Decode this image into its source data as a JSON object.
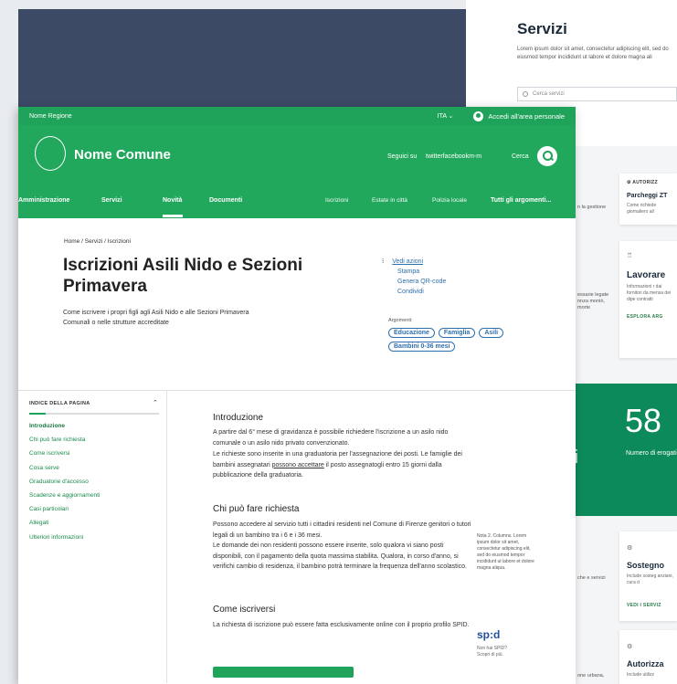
{
  "background": {
    "servizi_title": "Servizi",
    "servizi_desc": "Lorem ipsum dolor sit amet, consectetur adipiscing elit, sed do eiusmod tempor incididunt ut labore et dolore magna ali",
    "search_placeholder": "Cerca servizi",
    "card1_cat": "AUTORIZZ",
    "card1_title": "Parcheggi ZT",
    "card1_desc": "Come richiede giornaliero all",
    "card2_title": "Lavorare",
    "card2_desc": "Informazioni r dai fornitori da mensa dei dipe contratti",
    "card2_link": "ESPLORA ARG",
    "edge1": "n la gestione",
    "edge2": "essarie legate nnza moniò, morte",
    "stat_number": "58",
    "stat_label": "Numero di erogati",
    "stat_prefix": "ri",
    "card3_title": "Sostegno",
    "card3_desc": "Include sosteg anziani, cura d",
    "card3_link": "VEDI I SERVIZ",
    "edge3": "che e servizi",
    "card4_title": "Autorizza",
    "card4_desc": "Include utilizz",
    "edge4": "one urbana,"
  },
  "topbar": {
    "region": "Nome Regione",
    "lang": "ITA ⌄",
    "account": "Accedi all'area personale"
  },
  "header": {
    "site_name": "Nome Comune",
    "follow": "Seguici su",
    "social": "twitterfacebookm-m",
    "search": "Cerca"
  },
  "nav": {
    "items": [
      "Amministrazione",
      "Servizi",
      "Novità",
      "Documenti"
    ],
    "right_items": [
      "Iscrizioni",
      "Estate in città",
      "Polizia locale"
    ],
    "all_topics": "Tutti gli argomenti..."
  },
  "page": {
    "breadcrumb": "Home / Servizi / Iscrizioni",
    "title": "Iscrizioni Asili Nido e Sezioni Primavera",
    "subtitle": "Come iscrivere i propri figli agli Asili Nido e alle Sezioni Primavera Comunali o nelle strutture accreditate",
    "see_actions": "Vedi azioni",
    "actions": [
      "Stampa",
      "Genera QR-code",
      "Condividi"
    ],
    "topics_label": "Argomenti:",
    "topics": [
      "Educazione",
      "Famiglia",
      "Asili",
      "Bambini 0-36 mesi"
    ]
  },
  "toc": {
    "header": "INDICE DELLA PAGINA",
    "items": [
      "Introduzione",
      "Chi può fare richiesta",
      "Come iscriversi",
      "Cosa serve",
      "Graduatorie d'accesso",
      "Scadenze e aggiornamenti",
      "Casi particolari",
      "Allegati",
      "Ulteriori informazioni"
    ]
  },
  "sections": {
    "intro_title": "Introduzione",
    "intro_p1": "A partire dal 6° mese di gravidanza è possibile richiedere l'iscrizione a un asilo nido comunale o un asilo nido privato convenzionato.",
    "intro_p2a": "Le richieste sono inserite in una graduatoria per l'assegnazione dei posti. Le famiglie dei bambini assegnatari ",
    "intro_p2_link": "possono accettare",
    "intro_p2b": " il posto assegnatogli entro 15 giorni dalla pubblicazione della graduatoria.",
    "who_title": "Chi può fare richiesta",
    "who_p1": "Possono accedere al servizio tutti i cittadini residenti nel Comune di Firenze genitori o tutori legali di un bambino tra i 6 e i 36 mesi.",
    "who_p2": "Le domande dei non residenti possono essere inserite, solo qualora vi siano posti disponibili, con il pagamento della quota massima stabilita. Qualora, in corso d'anno, si verifichi cambio di residenza, il bambino potrà terminare la frequenza dell'anno scolastico.",
    "how_title": "Come iscriversi",
    "how_p1": "La richiesta di iscrizione può essere fatta esclusivamente online con il proprio profilo SPID."
  },
  "side": {
    "note": "Nota 2. Columns. Lorem ipsum dolor sit amet, consectetur adipiscing elit, sed do eiusmod tempor incididunt ut labore et dolore magna aliqua.",
    "spid_logo": "sp:d",
    "spid_desc1": "Non hai SPID?",
    "spid_desc2": "Scopri di più."
  }
}
